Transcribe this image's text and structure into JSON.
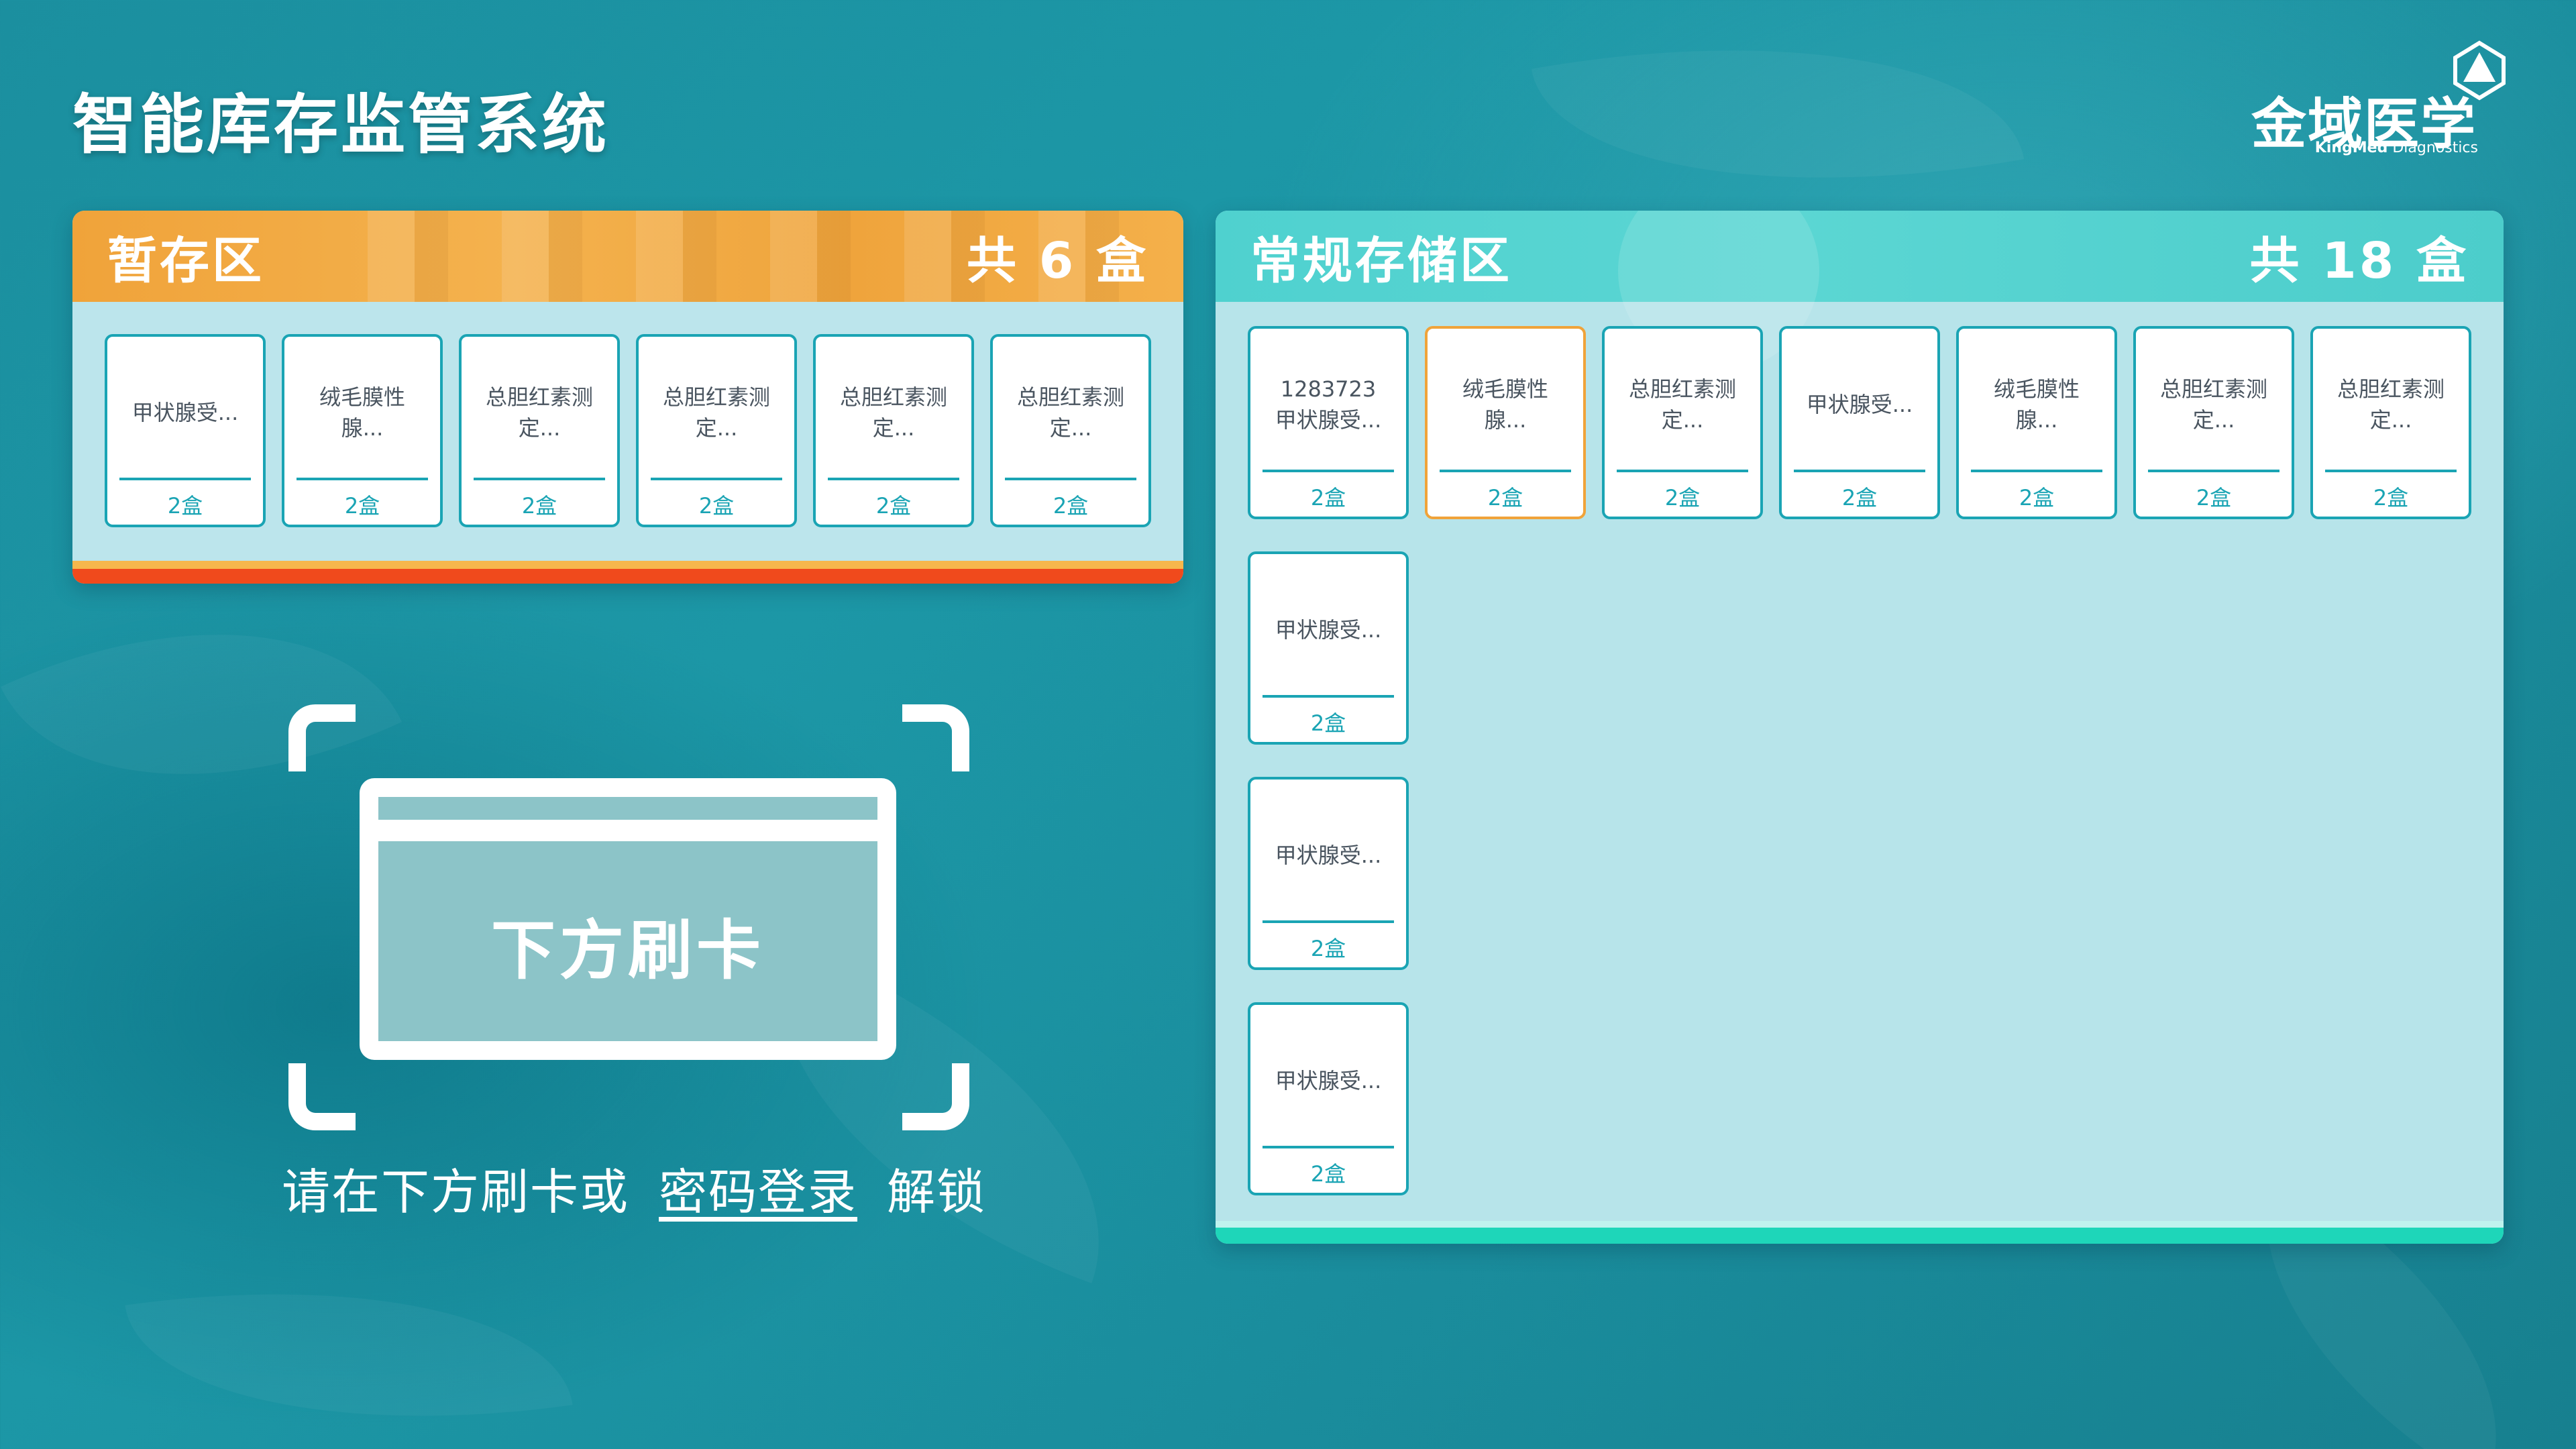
{
  "app": {
    "title": "智能库存监管系统"
  },
  "logo": {
    "cn": "金域医学",
    "en_bold": "KingMed",
    "en_rest": "Diagnostics"
  },
  "temp_zone": {
    "title": "暂存区",
    "count_label": "共 6 盒",
    "items": [
      {
        "name": "甲状腺受...",
        "qty": "2盒"
      },
      {
        "name": "绒毛膜性\n腺...",
        "qty": "2盒"
      },
      {
        "name": "总胆红素测\n定...",
        "qty": "2盒"
      },
      {
        "name": "总胆红素测\n定...",
        "qty": "2盒"
      },
      {
        "name": "总胆红素测\n定...",
        "qty": "2盒"
      },
      {
        "name": "总胆红素测\n定...",
        "qty": "2盒"
      }
    ]
  },
  "regular_zone": {
    "title": "常规存储区",
    "count_label": "共 18 盒",
    "items": [
      {
        "name": "1283723\n甲状腺受...",
        "qty": "2盒"
      },
      {
        "name": "绒毛膜性\n腺...",
        "qty": "2盒",
        "selected": true
      },
      {
        "name": "总胆红素测\n定...",
        "qty": "2盒"
      },
      {
        "name": "甲状腺受...",
        "qty": "2盒"
      },
      {
        "name": "绒毛膜性\n腺...",
        "qty": "2盒"
      },
      {
        "name": "总胆红素测\n定...",
        "qty": "2盒"
      },
      {
        "name": "总胆红素测\n定...",
        "qty": "2盒"
      },
      {
        "name": "甲状腺受...",
        "qty": "2盒"
      },
      {
        "name": "甲状腺受...",
        "qty": "2盒"
      },
      {
        "name": "甲状腺受...",
        "qty": "2盒"
      }
    ]
  },
  "swipe": {
    "card_text": "下方刷卡",
    "prompt_before": "请在下方刷卡或",
    "password_link": "密码登录",
    "prompt_after": "解锁"
  },
  "colors": {
    "accent": "#1aa4b4",
    "temp_header": "#f0a33a",
    "reg_header": "#4fd1cf",
    "selected_border": "#f0a33a"
  }
}
